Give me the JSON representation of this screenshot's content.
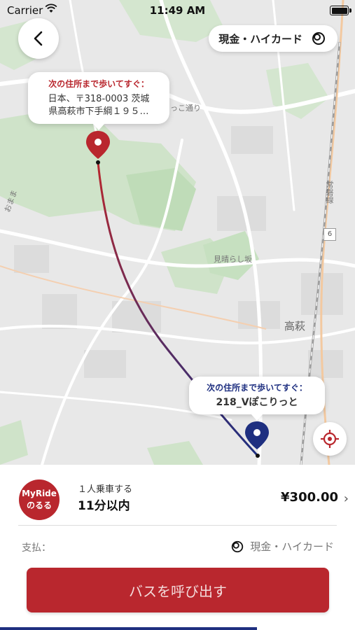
{
  "status_bar": {
    "carrier": "Carrier",
    "time": "11:49 AM"
  },
  "header": {
    "payment_chip_label": "現金・ハイカード"
  },
  "map": {
    "labels": {
      "hitachi_road": "たっこ通り",
      "area_left": "おまま",
      "shiraha_road": "見晴らし坂",
      "takahagi": "高萩",
      "route_shield": "6",
      "joban_line": "常磐線"
    },
    "start_bubble": {
      "title": "次の住所まで歩いてすぐ：",
      "address_line1": "日本、〒318-0003 茨城",
      "address_line2": "県高萩市下手綱１９５…"
    },
    "end_bubble": {
      "title": "次の住所まで歩いてすぐ：",
      "address": "218_Vぽこりっと"
    }
  },
  "ride": {
    "logo_line1": "MyRide",
    "logo_line2": "のるる",
    "passengers": "１人乗車する",
    "eta": "11分以内",
    "price": "¥300.00"
  },
  "payment": {
    "label": "支払：",
    "method": "現金・ハイカード"
  },
  "call_button_label": "バスを呼び出す",
  "colors": {
    "accent_red": "#b9272e",
    "accent_navy": "#1e2f80"
  }
}
